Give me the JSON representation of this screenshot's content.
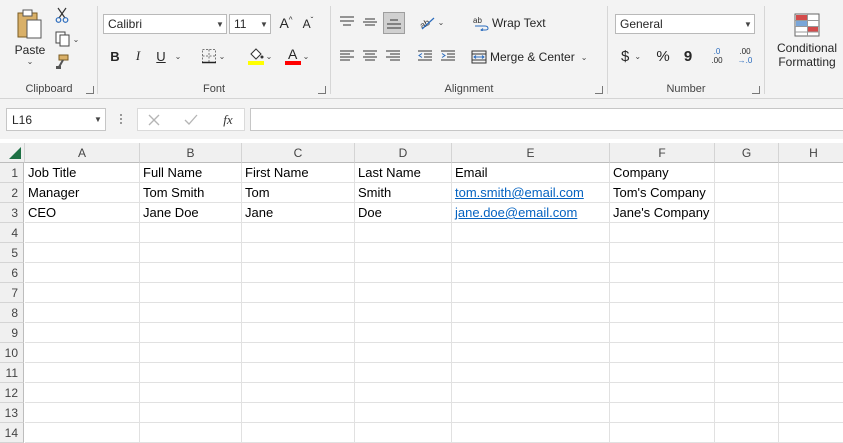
{
  "ribbon": {
    "clipboard": {
      "label": "Clipboard",
      "paste_label": "Paste"
    },
    "font": {
      "label": "Font",
      "font_name": "Calibri",
      "font_size": "11",
      "bold": "B",
      "italic": "I",
      "underline": "U",
      "font_color_glyph": "A"
    },
    "alignment": {
      "label": "Alignment",
      "wrap_text": "Wrap Text",
      "merge_center": "Merge & Center"
    },
    "number": {
      "label": "Number",
      "format": "General",
      "currency": "$",
      "percent": "%",
      "comma": "9",
      "inc_decimal_top": ".0",
      "inc_decimal_bottom": ".00",
      "dec_decimal_top": ".00",
      "dec_decimal_bottom": "→.0"
    },
    "styles": {
      "conditional_line1": "Conditional",
      "conditional_line2": "Formatting"
    }
  },
  "formula_bar": {
    "name_box": "L16",
    "fx": "fx",
    "formula": ""
  },
  "columns": [
    "A",
    "B",
    "C",
    "D",
    "E",
    "F",
    "G",
    "H"
  ],
  "rows": [
    "1",
    "2",
    "3",
    "4",
    "5",
    "6",
    "7",
    "8",
    "9",
    "10",
    "11",
    "12",
    "13",
    "14"
  ],
  "cells": [
    [
      "Job Title",
      "Full Name",
      "First Name",
      "Last Name",
      "Email",
      "Company",
      "",
      ""
    ],
    [
      "Manager",
      "Tom Smith",
      "Tom",
      "Smith",
      "tom.smith@email.com",
      "Tom's Company",
      "",
      ""
    ],
    [
      "CEO",
      "Jane Doe",
      "Jane",
      "Doe",
      "jane.doe@email.com",
      "Jane's Company",
      "",
      ""
    ]
  ],
  "colors": {
    "link": "#0563c1",
    "fill_highlight": "#ffff00",
    "font_color_bar": "#ff0000",
    "accent": "#217346"
  }
}
